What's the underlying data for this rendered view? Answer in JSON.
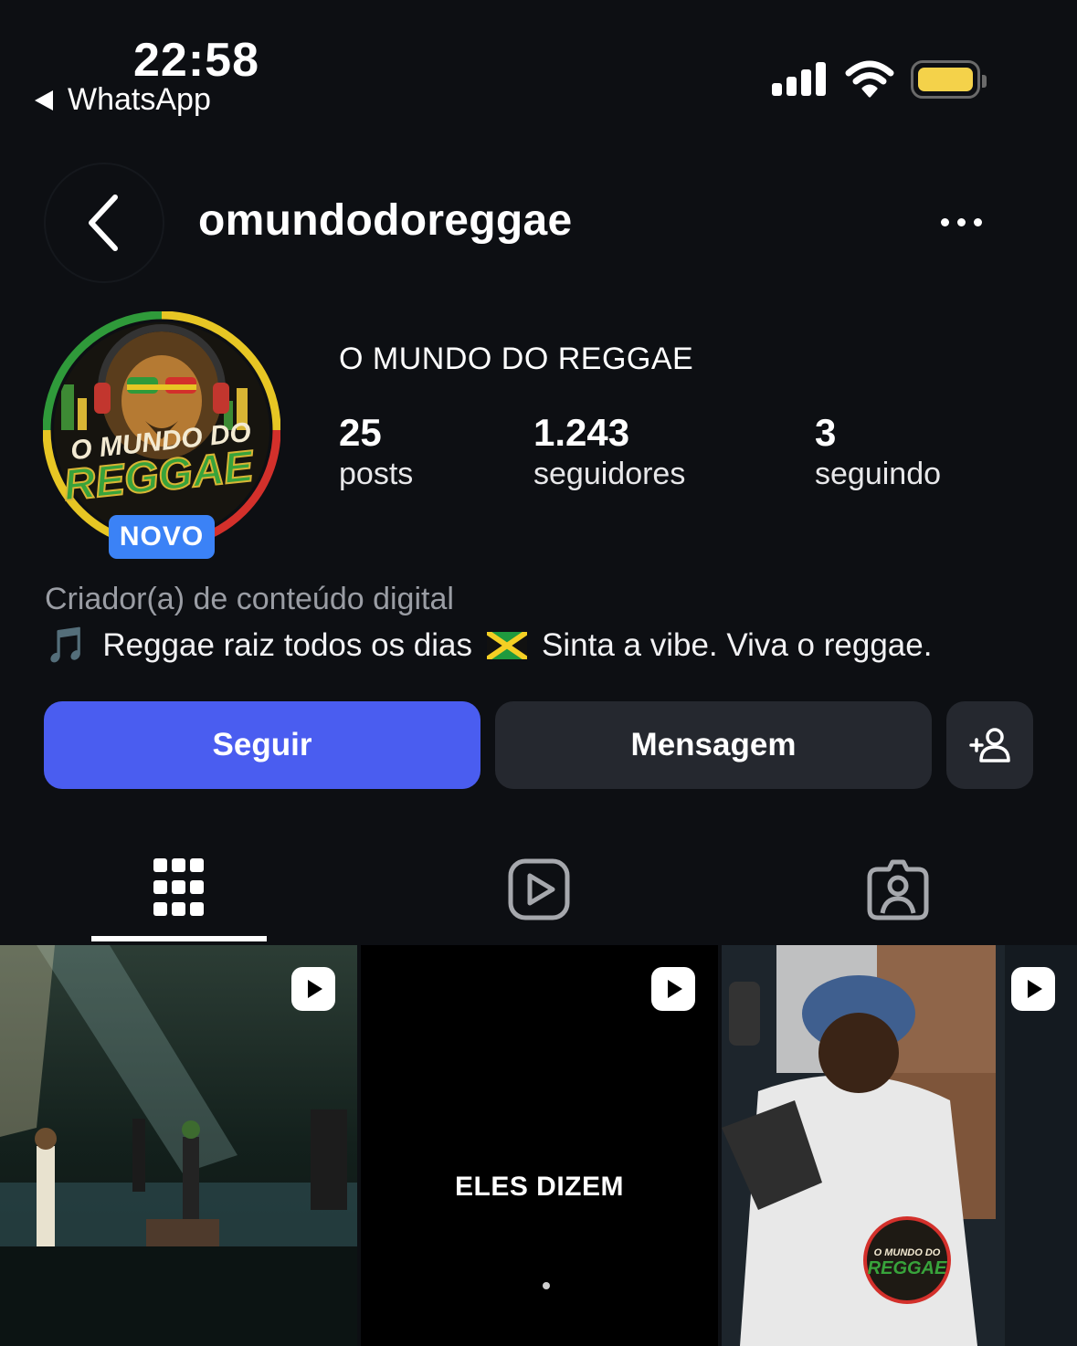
{
  "status_bar": {
    "time": "22:58",
    "back_app": "WhatsApp"
  },
  "header": {
    "username": "omundodoreggae"
  },
  "profile": {
    "avatar_logo_text": "O MUNDO DO REGGAE",
    "badge": "NOVO",
    "display_name": "O MUNDO DO REGGAE",
    "stats": [
      {
        "value": "25",
        "label": "posts"
      },
      {
        "value": "1.243",
        "label": "seguidores"
      },
      {
        "value": "3",
        "label": "seguindo"
      }
    ],
    "category": "Criador(a) de conteúdo digital",
    "bio_icon": "🎵",
    "bio_part1": "Reggae raiz todos os dias",
    "bio_flag": "jamaica-flag",
    "bio_part2": "Sinta a vibe. Viva o reggae."
  },
  "actions": {
    "follow": "Seguir",
    "message": "Mensagem",
    "add_icon": "add-person-icon"
  },
  "tabs": [
    {
      "icon": "grid-icon",
      "active": true
    },
    {
      "icon": "reels-icon",
      "active": false
    },
    {
      "icon": "tagged-icon",
      "active": false
    }
  ],
  "posts": [
    {
      "type": "reel",
      "scene": "concert-stage",
      "overlay": ""
    },
    {
      "type": "reel",
      "scene": "black-text",
      "overlay": "ELES DIZEM"
    },
    {
      "type": "reel",
      "scene": "crowd-dancing",
      "overlay": ""
    }
  ],
  "colors": {
    "follow": "#4a5df0",
    "badge": "#3b82f6",
    "background": "#0d0f13",
    "battery": "#f4d24a"
  }
}
